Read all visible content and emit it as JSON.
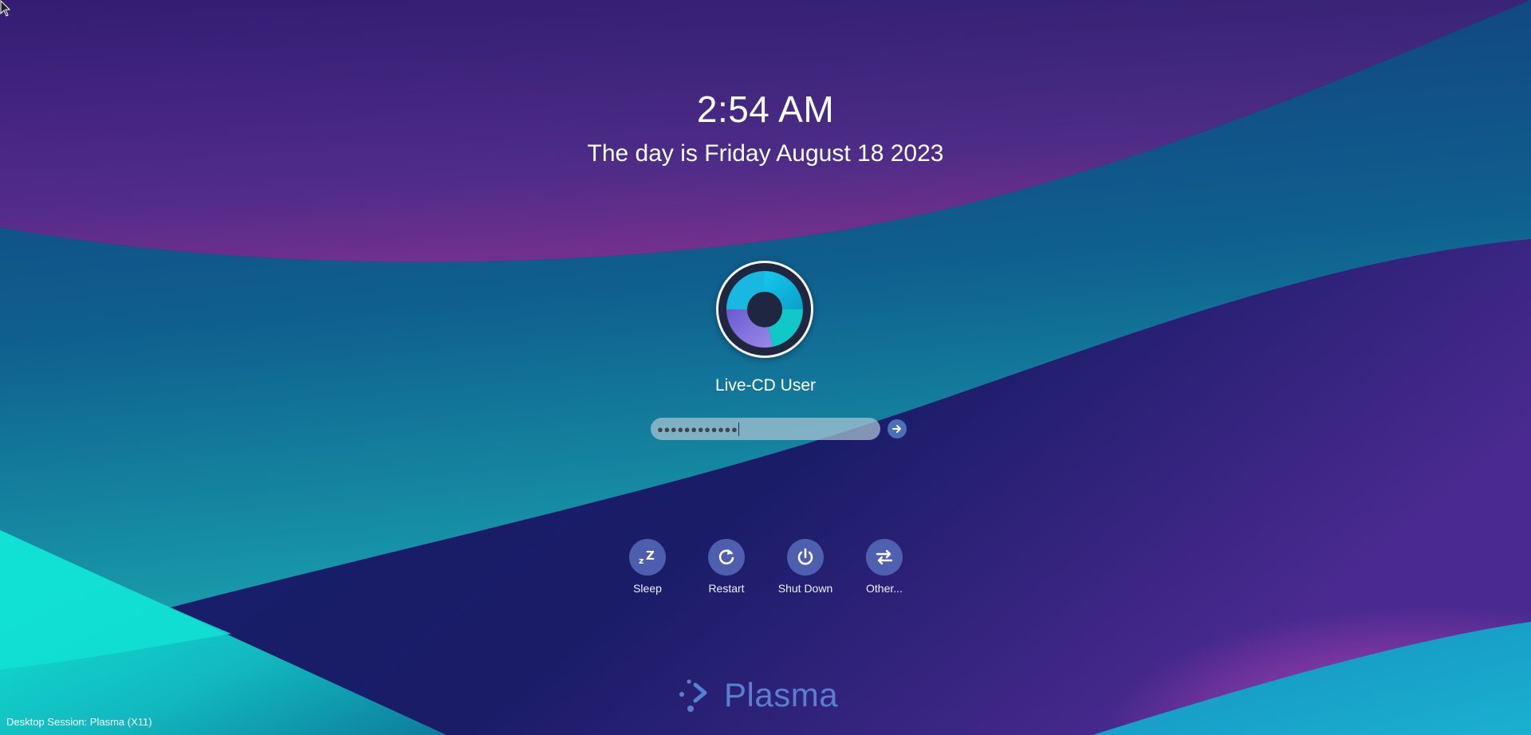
{
  "clock": {
    "time": "2:54 AM",
    "date": "The day is Friday August 18 2023"
  },
  "user": {
    "name": "Live-CD User",
    "avatar_icon": "user-avatar-icon"
  },
  "password": {
    "masked_value": "●●●●●●●●●●●●",
    "login_icon": "arrow-right-icon"
  },
  "actions": [
    {
      "label": "Sleep",
      "icon": "sleep-icon"
    },
    {
      "label": "Restart",
      "icon": "restart-icon"
    },
    {
      "label": "Shut Down",
      "icon": "power-icon"
    },
    {
      "label": "Other...",
      "icon": "switch-user-icon"
    }
  ],
  "branding": {
    "logo_text": "Plasma"
  },
  "session": {
    "label": "Desktop Session: Plasma (X11)"
  },
  "colors": {
    "background_dark": "#14185a",
    "magenta": "#c040b0",
    "cyan": "#10e8d8",
    "accent_blue": "#5b7fd0"
  }
}
